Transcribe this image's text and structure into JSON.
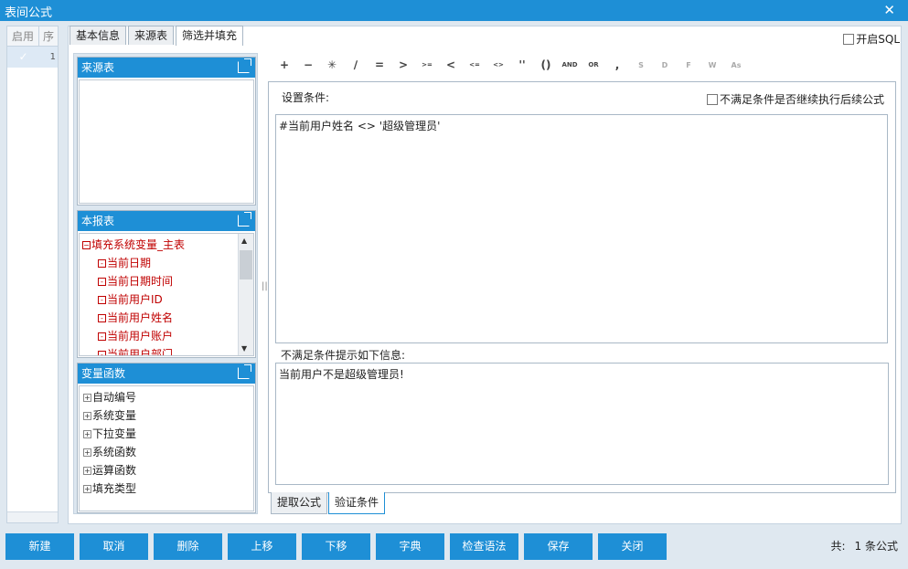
{
  "window": {
    "title": "表间公式"
  },
  "formula_list": {
    "col_enabled": "启用",
    "col_seq": "序",
    "rows": [
      {
        "seq": "1"
      }
    ]
  },
  "tabs": [
    "基本信息",
    "来源表",
    "筛选并填充"
  ],
  "sql_label": "开启SQL",
  "source_panel": {
    "title": "来源表"
  },
  "report_panel": {
    "title": "本报表",
    "root": "填充系统变量_主表",
    "items": [
      "当前日期",
      "当前日期时间",
      "当前用户ID",
      "当前用户姓名",
      "当前用户账户",
      "当前用户部门"
    ]
  },
  "var_panel": {
    "title": "变量函数",
    "items": [
      "自动编号",
      "系统变量",
      "下拉变量",
      "系统函数",
      "运算函数",
      "填充类型"
    ]
  },
  "toolbar": [
    "+",
    "−",
    "✳",
    "∕",
    "=",
    ">",
    ">=",
    "<",
    "<=",
    "<>",
    "''",
    "()",
    "AND",
    "OR",
    ",",
    "S",
    "D",
    "F",
    "W",
    "As"
  ],
  "condition": {
    "label": "设置条件:",
    "continue_label": "不满足条件是否继续执行后续公式",
    "expression": "#当前用户姓名 <> '超级管理员'"
  },
  "message": {
    "label": "不满足条件提示如下信息:",
    "text": "当前用户不是超级管理员!"
  },
  "bottom_tabs": [
    "提取公式",
    "验证条件"
  ],
  "buttons": [
    "新建",
    "取消",
    "删除",
    "上移",
    "下移",
    "字典",
    "检查语法",
    "保存",
    "关闭"
  ],
  "count": {
    "label": "共:",
    "value": "1 条公式"
  },
  "colors": {
    "accent": "#1e8fd6",
    "tree_red": "#c00000"
  }
}
